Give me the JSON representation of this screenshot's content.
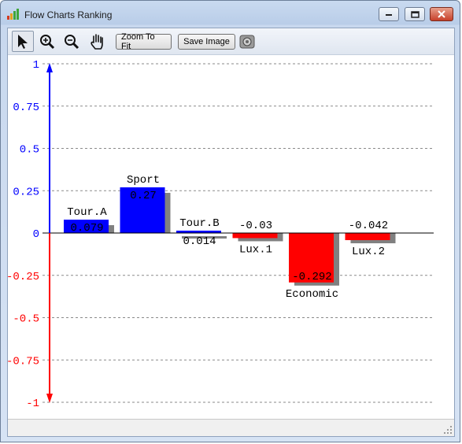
{
  "window": {
    "title": "Flow Charts Ranking"
  },
  "toolbar": {
    "tools": [
      "pointer-icon",
      "zoom-in-icon",
      "zoom-out-icon",
      "pan-hand-icon"
    ],
    "zoom_to_fit_label": "Zoom To Fit",
    "save_image_label": "Save Image",
    "extra_icon": "camera-icon"
  },
  "colors": {
    "positive": "#0000ff",
    "negative": "#ff0000",
    "shadow": "#808080",
    "grid": "#8a8a8a"
  },
  "chart_data": {
    "type": "bar",
    "title": "",
    "xlabel": "",
    "ylabel": "",
    "ylim": [
      -1,
      1
    ],
    "yticks": [
      1,
      0.75,
      0.5,
      0.25,
      0,
      -0.25,
      -0.5,
      -0.75,
      -1
    ],
    "ytick_labels": [
      "1",
      "0.75",
      "0.5",
      "0.25",
      "0",
      "-0.25",
      "-0.5",
      "-0.75",
      "-1"
    ],
    "grid": "horizontal dashed",
    "categories": [
      "Tour.A",
      "Sport",
      "Tour.B",
      "Lux.1",
      "Economic",
      "Lux.2"
    ],
    "values": [
      0.079,
      0.27,
      0.014,
      -0.03,
      -0.292,
      -0.042
    ],
    "value_labels": [
      "0.079",
      "0.27",
      "0.014",
      "-0.03",
      "-0.292",
      "-0.042"
    ]
  }
}
